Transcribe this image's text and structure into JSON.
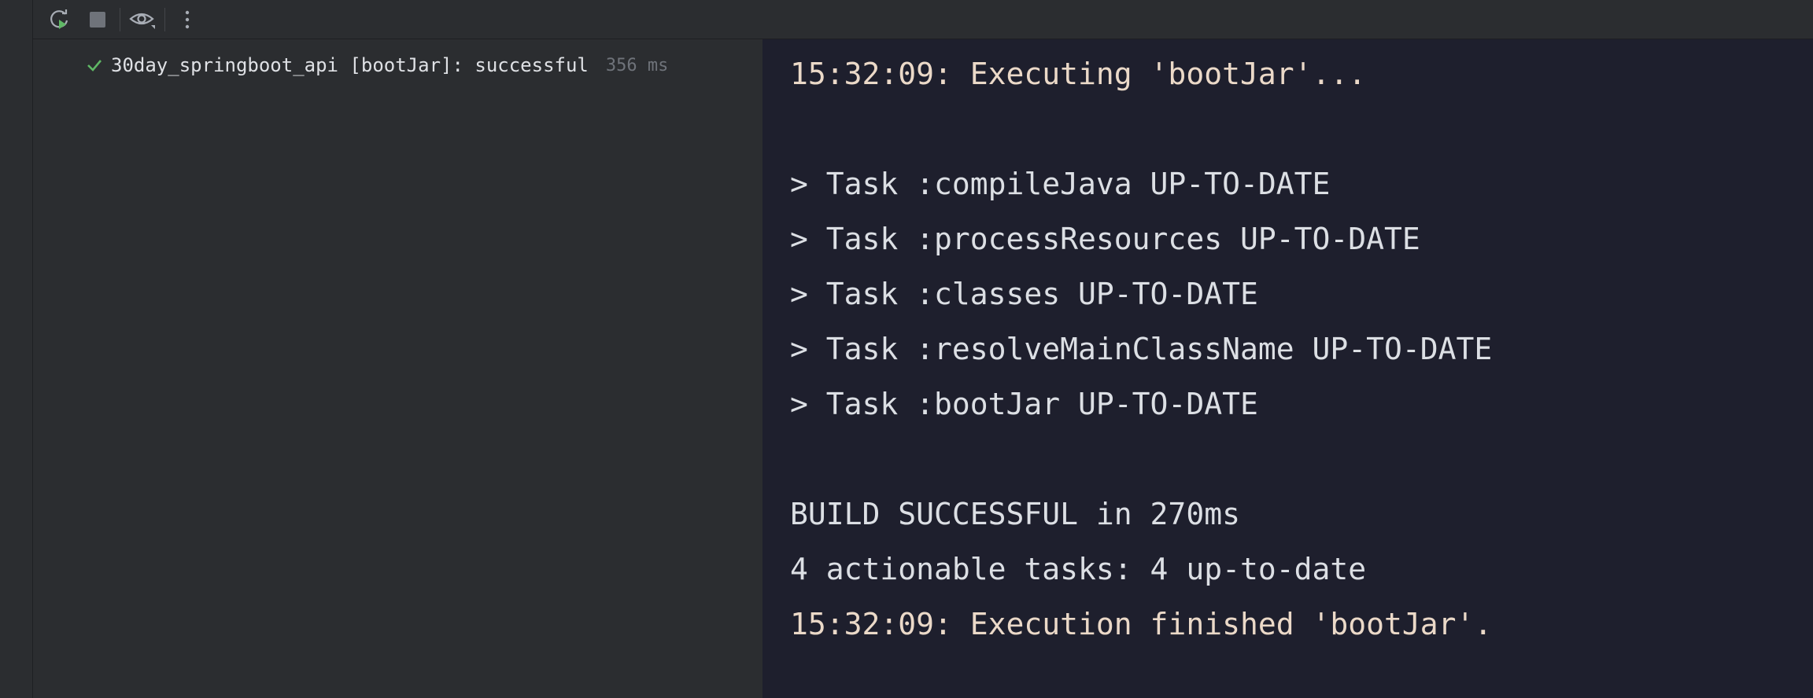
{
  "toolbar": {
    "rerun_icon": "rerun-icon",
    "stop_icon": "stop-icon",
    "view_icon": "eye-icon",
    "more_icon": "more-vertical-icon"
  },
  "tree": {
    "item_label": "30day_springboot_api [bootJar]: successful",
    "item_time": "356 ms",
    "status": "success",
    "status_color": "#5fb865"
  },
  "console": {
    "start_line": "15:32:09: Executing 'bootJar'...",
    "tasks": [
      "> Task :compileJava UP-TO-DATE",
      "> Task :processResources UP-TO-DATE",
      "> Task :classes UP-TO-DATE",
      "> Task :resolveMainClassName UP-TO-DATE",
      "> Task :bootJar UP-TO-DATE"
    ],
    "build_result": "BUILD SUCCESSFUL in 270ms",
    "summary": "4 actionable tasks: 4 up-to-date",
    "end_line": "15:32:09: Execution finished 'bootJar'."
  }
}
